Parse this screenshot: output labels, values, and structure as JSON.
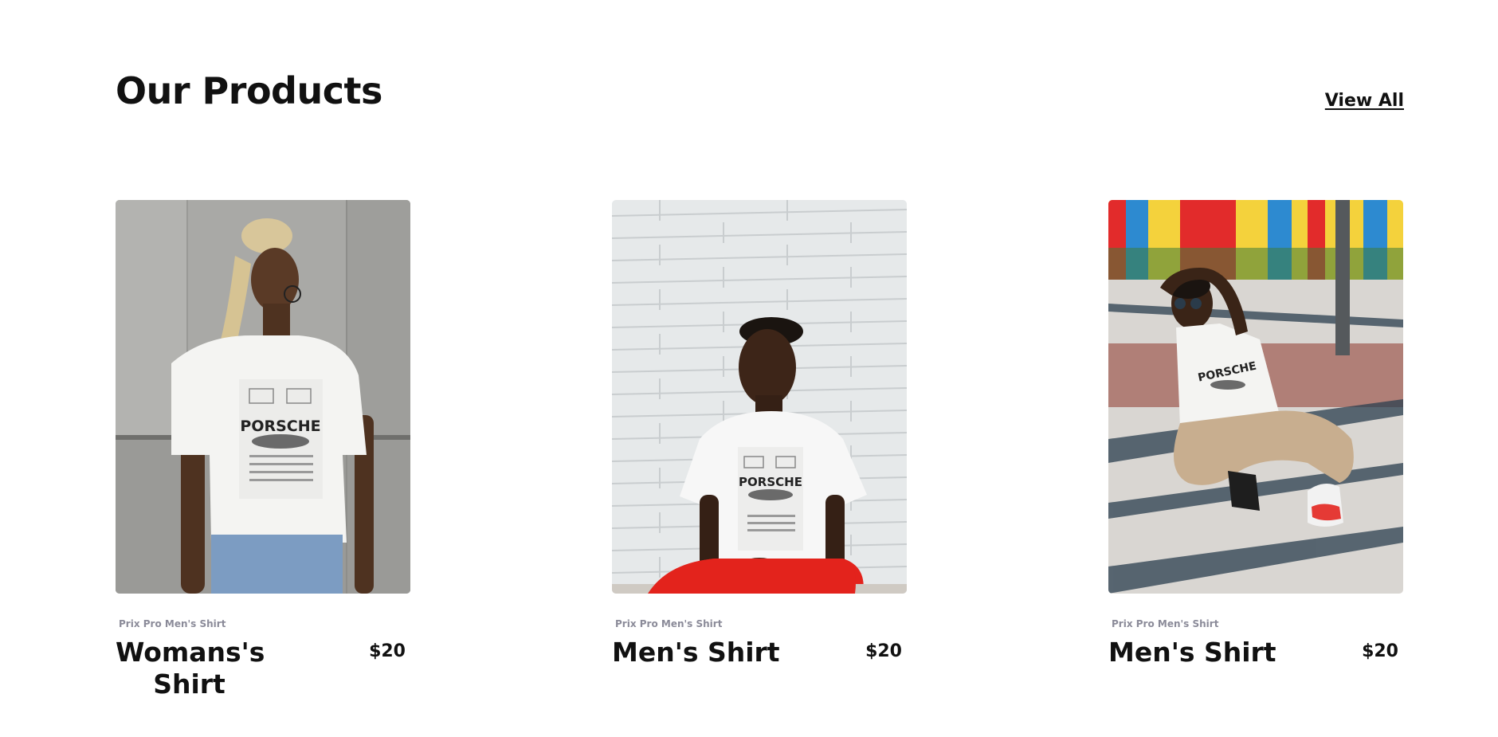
{
  "section": {
    "title": "Our Products",
    "view_all_label": "View All"
  },
  "colors": {
    "text": "#111111",
    "brand_text": "#8b8b99",
    "background": "#ffffff"
  },
  "products": [
    {
      "brand": "Prix Pro Men's Shirt",
      "name": "Womans's Shirt",
      "price": "$20",
      "print_text": "PORSCHE"
    },
    {
      "brand": "Prix Pro Men's Shirt",
      "name": "Men's Shirt",
      "price": "$20",
      "print_text": "PORSCHE"
    },
    {
      "brand": "Prix Pro Men's Shirt",
      "name": "Men's Shirt",
      "price": "$20",
      "print_text": "PORSCHE"
    }
  ]
}
